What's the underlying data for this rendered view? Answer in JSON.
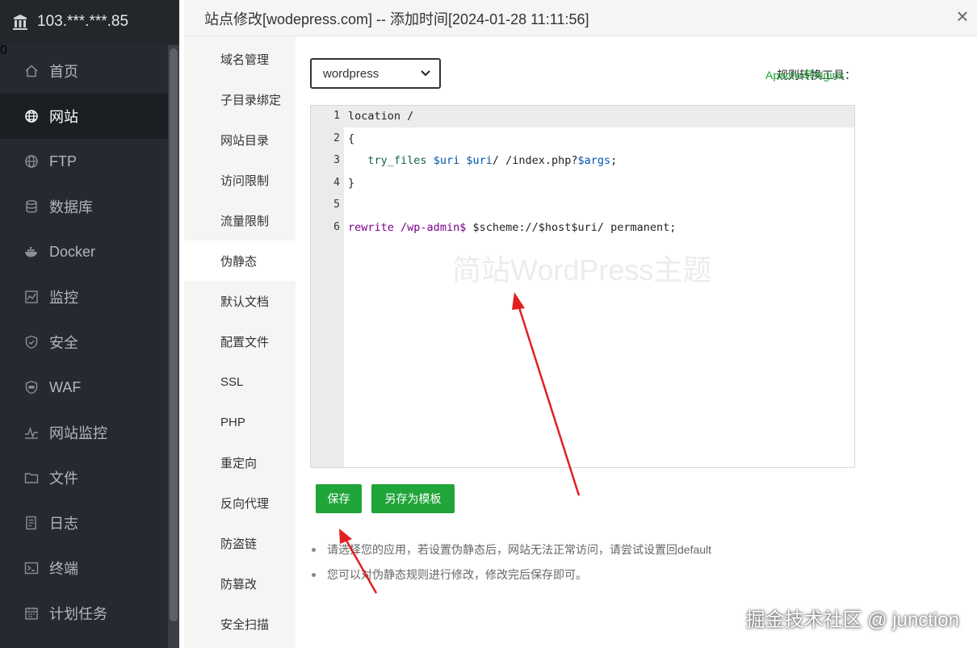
{
  "sidebar": {
    "server": "103.***.***.85",
    "badge": "0",
    "items": [
      {
        "label": "首页",
        "icon": "home-icon"
      },
      {
        "label": "网站",
        "icon": "globe-icon",
        "active": true
      },
      {
        "label": "FTP",
        "icon": "ftp-globe-icon"
      },
      {
        "label": "数据库",
        "icon": "database-icon"
      },
      {
        "label": "Docker",
        "icon": "docker-icon"
      },
      {
        "label": "监控",
        "icon": "monitor-icon"
      },
      {
        "label": "安全",
        "icon": "shield-icon"
      },
      {
        "label": "WAF",
        "icon": "waf-shield-icon"
      },
      {
        "label": "网站监控",
        "icon": "pulse-icon"
      },
      {
        "label": "文件",
        "icon": "folder-icon"
      },
      {
        "label": "日志",
        "icon": "log-icon"
      },
      {
        "label": "终端",
        "icon": "terminal-icon"
      },
      {
        "label": "计划任务",
        "icon": "calendar-icon"
      }
    ]
  },
  "dialog": {
    "title": "站点修改[wodepress.com] -- 添加时间[2024-01-28 11:11:56]",
    "close": "×"
  },
  "tabs": [
    "域名管理",
    "子目录绑定",
    "网站目录",
    "访问限制",
    "流量限制",
    "伪静态",
    "默认文档",
    "配置文件",
    "SSL",
    "PHP",
    "重定向",
    "反向代理",
    "防盗链",
    "防篡改",
    "安全扫描"
  ],
  "active_tab": "伪静态",
  "rewrite": {
    "select_value": "wordpress",
    "tool_label": "规则转换工具：",
    "tool_link": "Apache转Nginx",
    "line_numbers": [
      "1",
      "2",
      "3",
      "4",
      "5",
      "6"
    ],
    "code": [
      "location /",
      "{",
      "   try_files $uri $uri/ /index.php?$args;",
      "}",
      "",
      "rewrite /wp-admin$ $scheme://$host$uri/ permanent;"
    ],
    "editor_watermark": "简站WordPress主题",
    "save_label": "保存",
    "save_template_label": "另存为模板",
    "tips": [
      "请选择您的应用，若设置伪静态后，网站无法正常访问，请尝试设置回default",
      "您可以对伪静态规则进行修改，修改完后保存即可。"
    ]
  },
  "watermark": "掘金技术社区 @ junction",
  "colors": {
    "accent": "#20a53a",
    "sidebar": "#262a30",
    "badge": "#d9601e",
    "arrow": "#e02020"
  }
}
